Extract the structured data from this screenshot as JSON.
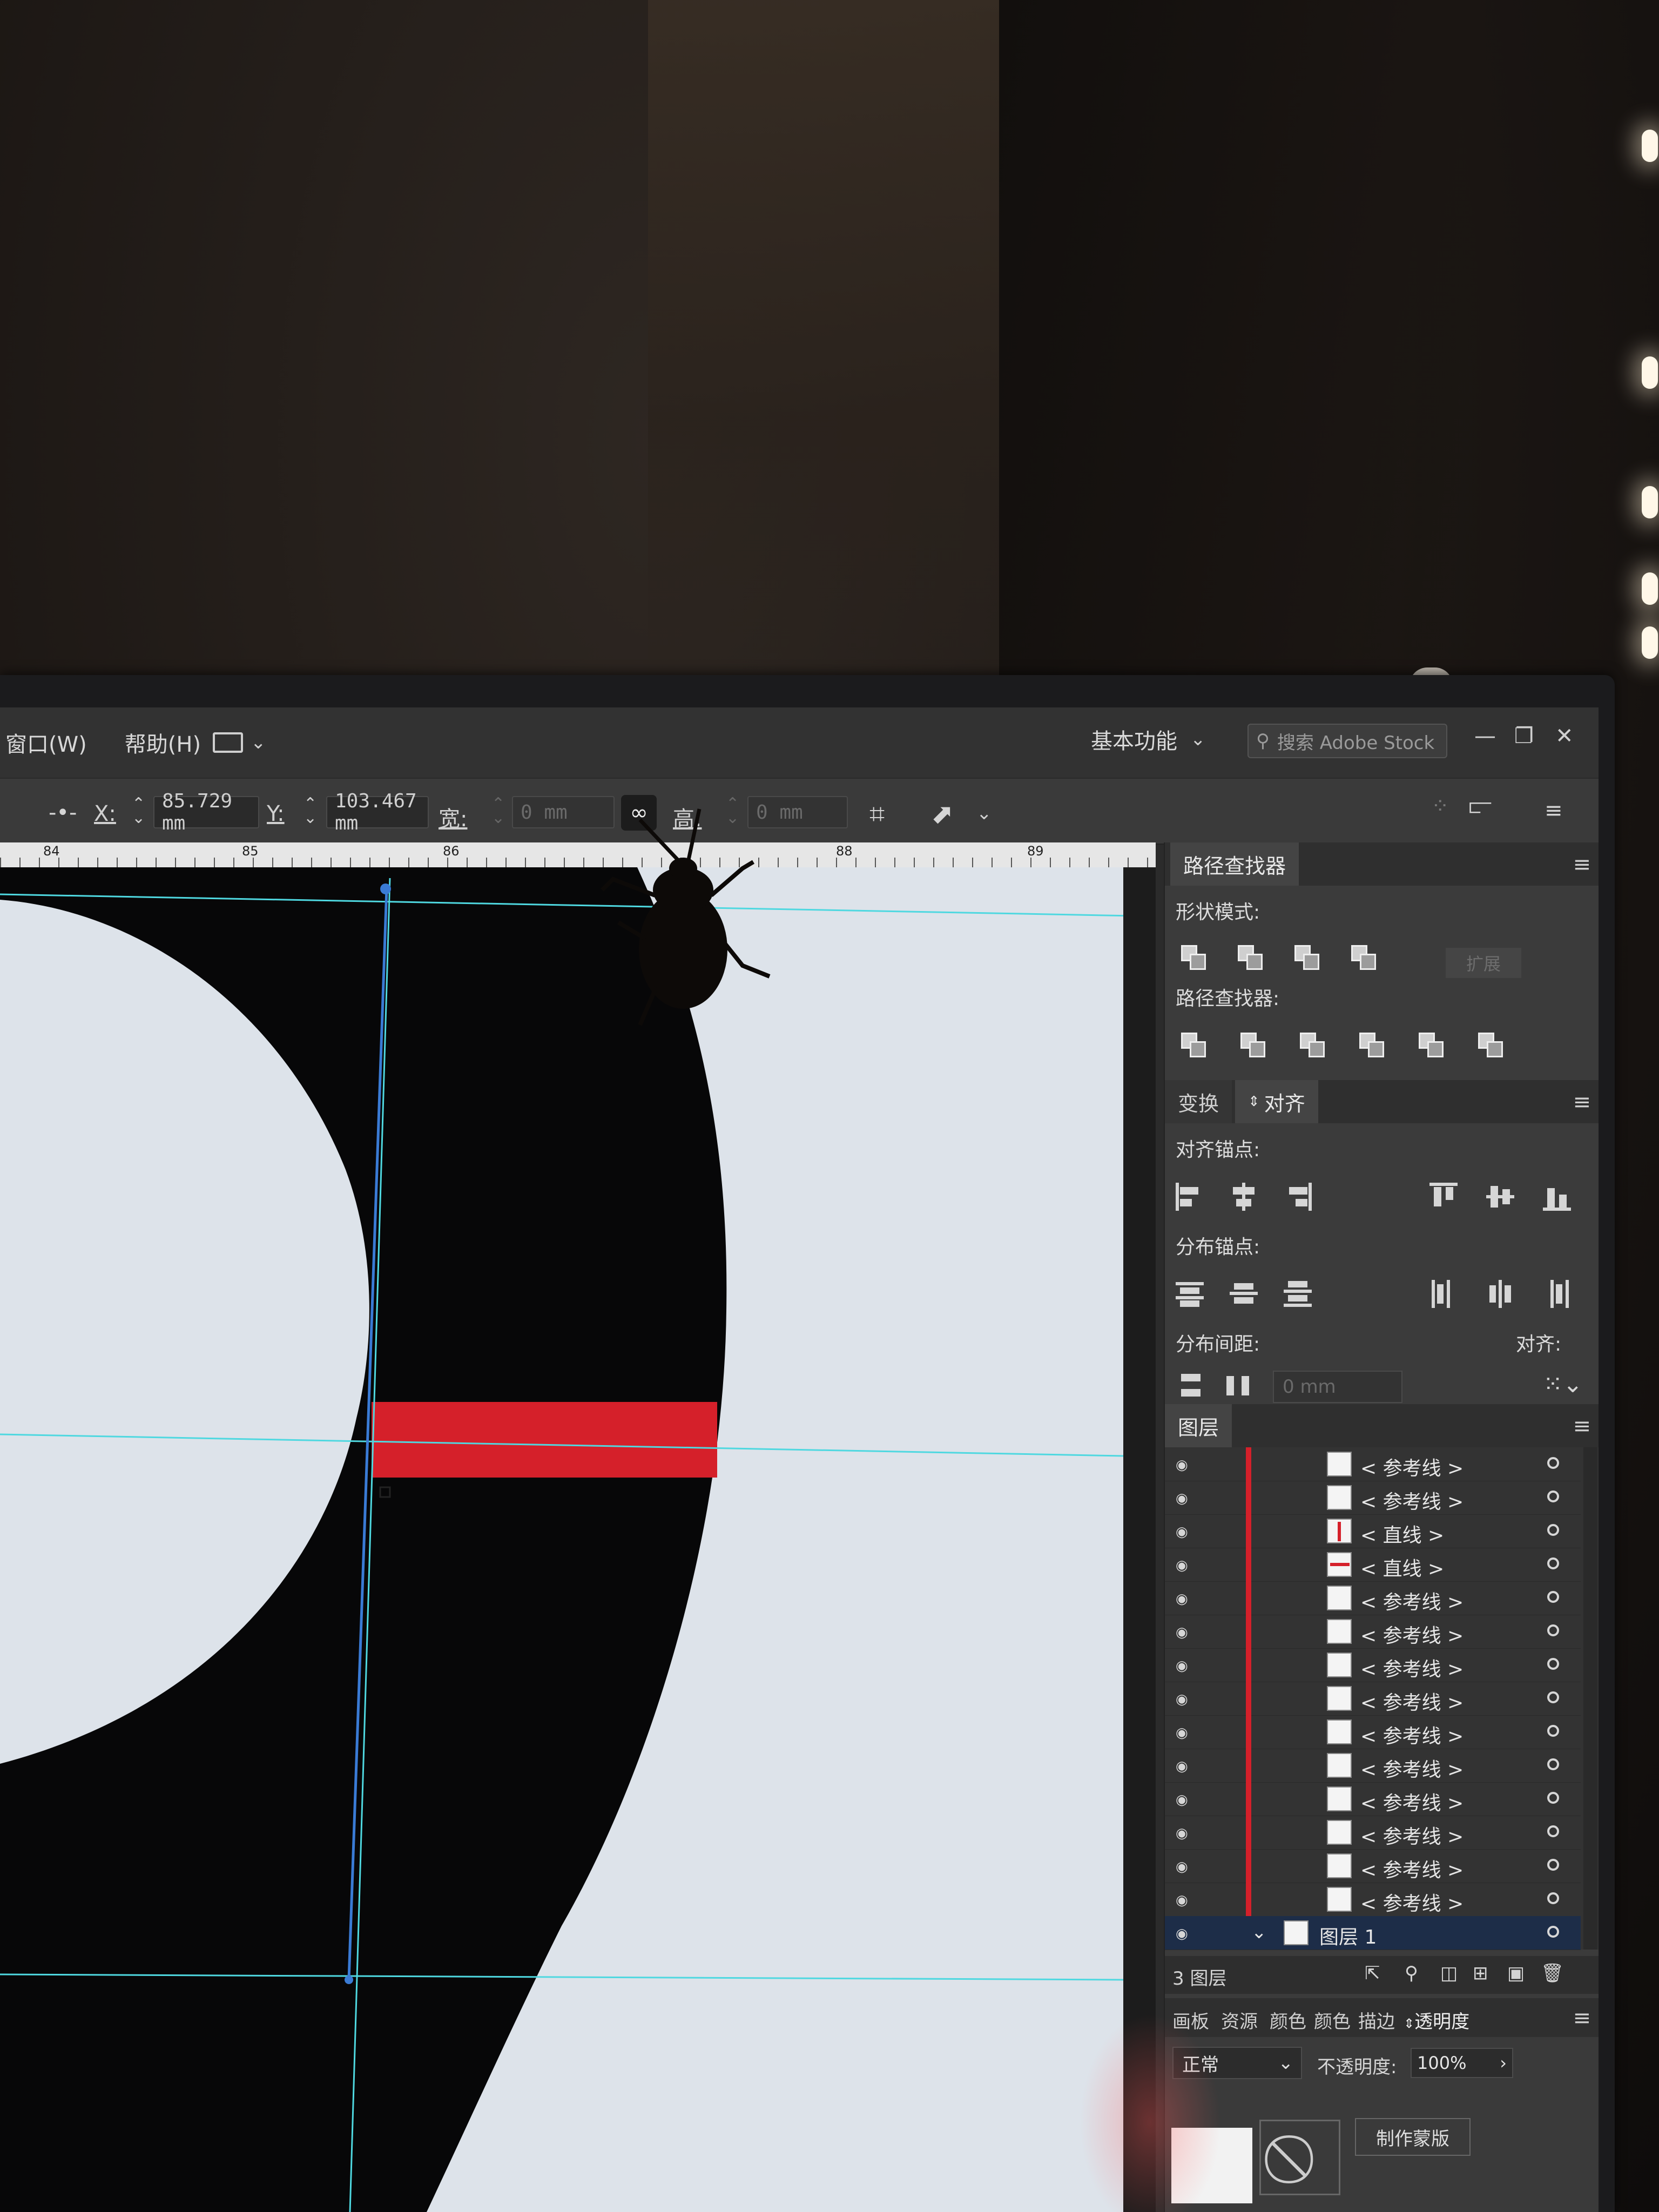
{
  "menu": {
    "window_label": "窗口(W)",
    "help_label": "帮助(H)",
    "workspace_label": "基本功能",
    "search_placeholder": "搜索 Adobe Stock"
  },
  "control_bar": {
    "x_label": "X:",
    "x_value": "85.729 mm",
    "y_label": "Y:",
    "y_value": "103.467 mm",
    "width_label": "宽:",
    "width_value": "0 mm",
    "height_label": "高:",
    "height_value": "0 mm"
  },
  "ruler": {
    "ticks": [
      "84",
      "85",
      "86",
      "88",
      "89"
    ]
  },
  "pathfinder": {
    "tab": "路径查找器",
    "shape_modes_label": "形状模式:",
    "pathfinders_label": "路径查找器:",
    "expand_label": "扩展"
  },
  "align": {
    "tab_transform": "变换",
    "tab_align": "对齐",
    "align_objects_label": "对齐锚点:",
    "distribute_objects_label": "分布锚点:",
    "distribute_spacing_label": "分布间距:",
    "align_to_label": "对齐:",
    "spacing_value": "0 mm"
  },
  "layers": {
    "tab": "图层",
    "rows": [
      {
        "name": "< 参考线 >",
        "type": "guide"
      },
      {
        "name": "< 参考线 >",
        "type": "guide"
      },
      {
        "name": "< 直线 >",
        "type": "line-v"
      },
      {
        "name": "< 直线 >",
        "type": "line-h"
      },
      {
        "name": "< 参考线 >",
        "type": "guide"
      },
      {
        "name": "< 参考线 >",
        "type": "guide"
      },
      {
        "name": "< 参考线 >",
        "type": "guide"
      },
      {
        "name": "< 参考线 >",
        "type": "guide"
      },
      {
        "name": "< 参考线 >",
        "type": "guide"
      },
      {
        "name": "< 参考线 >",
        "type": "guide"
      },
      {
        "name": "< 参考线 >",
        "type": "guide"
      },
      {
        "name": "< 参考线 >",
        "type": "guide"
      },
      {
        "name": "< 参考线 >",
        "type": "guide"
      },
      {
        "name": "< 参考线 >",
        "type": "guide"
      }
    ],
    "top_layer_name": "图层 1",
    "count_label": "3 图层"
  },
  "bottom_tabs": {
    "artboards": "画板",
    "assets": "资源",
    "color1": "颜色",
    "color2": "颜色",
    "stroke": "描边",
    "transparency": "透明度"
  },
  "transparency": {
    "blend_mode": "正常",
    "opacity_label": "不透明度:",
    "opacity_value": "100%",
    "make_mask_label": "制作蒙版"
  },
  "colors": {
    "accent_red": "#d5202a",
    "guide_cyan": "#4fd8e0",
    "selection_blue": "#3a7bd5"
  }
}
